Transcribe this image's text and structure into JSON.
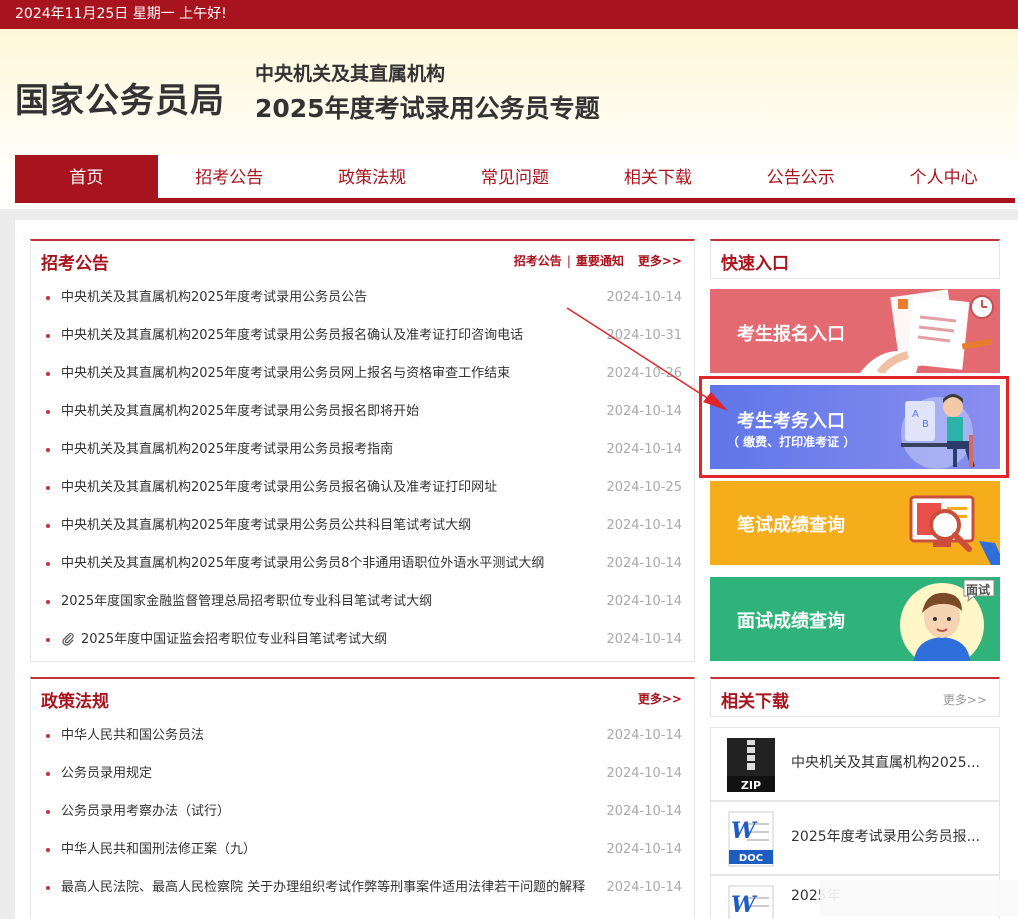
{
  "topbar": {
    "text": "2024年11月25日  星期一  上午好!"
  },
  "header": {
    "logo": "国家公务员局",
    "subtitle1": "中央机关及其直属机构",
    "subtitle2": "2025年度考试录用公务员专题"
  },
  "nav": {
    "items": [
      {
        "label": "首页"
      },
      {
        "label": "招考公告"
      },
      {
        "label": "政策法规"
      },
      {
        "label": "常见问题"
      },
      {
        "label": "相关下载"
      },
      {
        "label": "公告公示"
      },
      {
        "label": "个人中心"
      }
    ]
  },
  "announcements": {
    "title": "招考公告",
    "link1": "招考公告",
    "link2": "重要通知",
    "more": "更多>>",
    "items": [
      {
        "title": "中央机关及其直属机构2025年度考试录用公务员公告",
        "date": "2024-10-14"
      },
      {
        "title": "中央机关及其直属机构2025年度考试录用公务员报名确认及准考证打印咨询电话",
        "date": "2024-10-31"
      },
      {
        "title": "中央机关及其直属机构2025年度考试录用公务员网上报名与资格审查工作结束",
        "date": "2024-10-26"
      },
      {
        "title": "中央机关及其直属机构2025年度考试录用公务员报名即将开始",
        "date": "2024-10-14"
      },
      {
        "title": "中央机关及其直属机构2025年度考试录用公务员报考指南",
        "date": "2024-10-14"
      },
      {
        "title": "中央机关及其直属机构2025年度考试录用公务员报名确认及准考证打印网址",
        "date": "2024-10-25"
      },
      {
        "title": "中央机关及其直属机构2025年度考试录用公务员公共科目笔试考试大纲",
        "date": "2024-10-14"
      },
      {
        "title": "中央机关及其直属机构2025年度考试录用公务员8个非通用语职位外语水平测试大纲",
        "date": "2024-10-14"
      },
      {
        "title": "2025年度国家金融监督管理总局招考职位专业科目笔试考试大纲",
        "date": "2024-10-14"
      },
      {
        "title": "2025年度中国证监会招考职位专业科目笔试考试大纲",
        "date": "2024-10-14"
      }
    ]
  },
  "policies": {
    "title": "政策法规",
    "more": "更多>>",
    "items": [
      {
        "title": "中华人民共和国公务员法",
        "date": "2024-10-14"
      },
      {
        "title": "公务员录用规定",
        "date": "2024-10-14"
      },
      {
        "title": "公务员录用考察办法（试行）",
        "date": "2024-10-14"
      },
      {
        "title": "中华人民共和国刑法修正案（九）",
        "date": "2024-10-14"
      },
      {
        "title": "最高人民法院、最高人民检察院 关于办理组织考试作弊等刑事案件适用法律若干问题的解释",
        "date": "2024-10-14"
      }
    ]
  },
  "quick": {
    "title": "快速入口",
    "registration": "考生报名入口",
    "services": "考生考务入口",
    "services_sub": "（ 缴费、打印准考证 ）",
    "written_score": "笔试成绩查询",
    "interview_score": "面试成绩查询",
    "interview_badge": "面试"
  },
  "downloads": {
    "title": "相关下载",
    "more": "更多>>",
    "items": [
      {
        "name": "中央机关及其直属机构2025...",
        "type": "ZIP"
      },
      {
        "name": "2025年度考试录用公务员报...",
        "type": "DOC"
      },
      {
        "name": "2025年",
        "type": "DOC"
      }
    ]
  },
  "colors": {
    "brand_red": "#a8141e",
    "registration_bg": "#e36a70",
    "services_bg": "#6b7ee9",
    "written_bg": "#f6ad1c",
    "interview_bg": "#2fb37a",
    "highlight": "#e3242b"
  }
}
